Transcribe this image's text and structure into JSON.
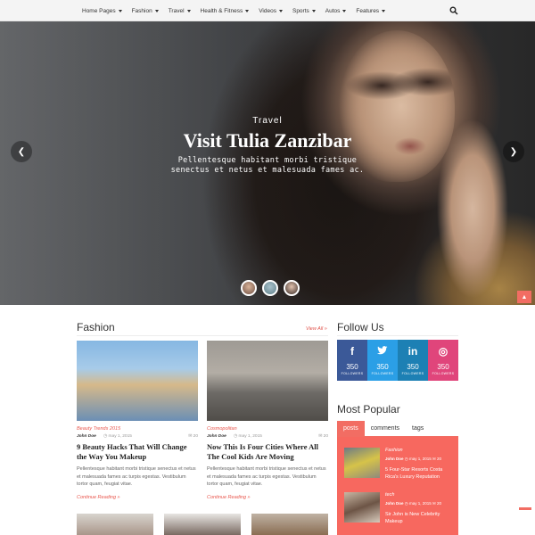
{
  "nav": {
    "items": [
      "Home Pages",
      "Fashion",
      "Travel",
      "Health & Fitness",
      "Videos",
      "Sports",
      "Autos",
      "Features"
    ],
    "search_icon": "search-icon"
  },
  "hero": {
    "category": "Travel",
    "title": "Visit Tulia Zanzibar",
    "description_line1": "Pellentesque habitant morbi tristique",
    "description_line2": "senectus et netus et malesuada fames ac.",
    "prev_icon": "chevron-left-icon",
    "next_icon": "chevron-right-icon"
  },
  "fashion": {
    "title": "Fashion",
    "view_all": "View All »",
    "posts": [
      {
        "category": "Beauty Trends 2015",
        "author": "John Doe",
        "date": "may 1, 2015",
        "comments": "20",
        "title": "9 Beauty Hacks That Will Change the Way You Makeup",
        "excerpt": "Pellentesque habitant morbi tristique senectus et netus et malesuada fames ac turpis egestas. Vestibulum tortor quam, feugiat vitae.",
        "continue": "Continue Reading »"
      },
      {
        "category": "Cosmopolitan",
        "author": "John Doe",
        "date": "may 1, 2015",
        "comments": "20",
        "title": "Now This Is Four Cities Where All The Cool Kids Are Moving",
        "excerpt": "Pellentesque habitant morbi tristique senectus et netus et malesuada fames ac turpis egestas. Vestibulum tortor quam, feugiat vitae.",
        "continue": "Continue Reading »"
      }
    ]
  },
  "follow": {
    "title": "Follow Us",
    "networks": [
      {
        "icon": "f",
        "count": "350",
        "label": "FOLLOWERS",
        "color": "#3b5998"
      },
      {
        "icon": "🐦",
        "count": "350",
        "label": "FOLLOWERS",
        "color": "#2b9fe6"
      },
      {
        "icon": "in",
        "count": "350",
        "label": "FOLLOWERS",
        "color": "#1d80b4"
      },
      {
        "icon": "◎",
        "count": "350",
        "label": "FOLLOWERS",
        "color": "#e0457b"
      }
    ]
  },
  "popular": {
    "title": "Most Popular",
    "tabs": [
      "posts",
      "comments",
      "tags"
    ],
    "items": [
      {
        "category": "Fashion",
        "author": "John Doe",
        "date": "may 1, 2015",
        "comments": "20",
        "title": "5 Four-Star Resorts Costa Rica's Luxury Reputation"
      },
      {
        "category": "tech",
        "author": "John Doe",
        "date": "may 1, 2015",
        "comments": "20",
        "title": "Sir John is New Celebrity Makeup"
      }
    ]
  },
  "colors": {
    "accent": "#f26d63",
    "facebook": "#3b5998",
    "twitter": "#2b9fe6",
    "linkedin": "#1d80b4",
    "dribbble": "#e0457b"
  }
}
